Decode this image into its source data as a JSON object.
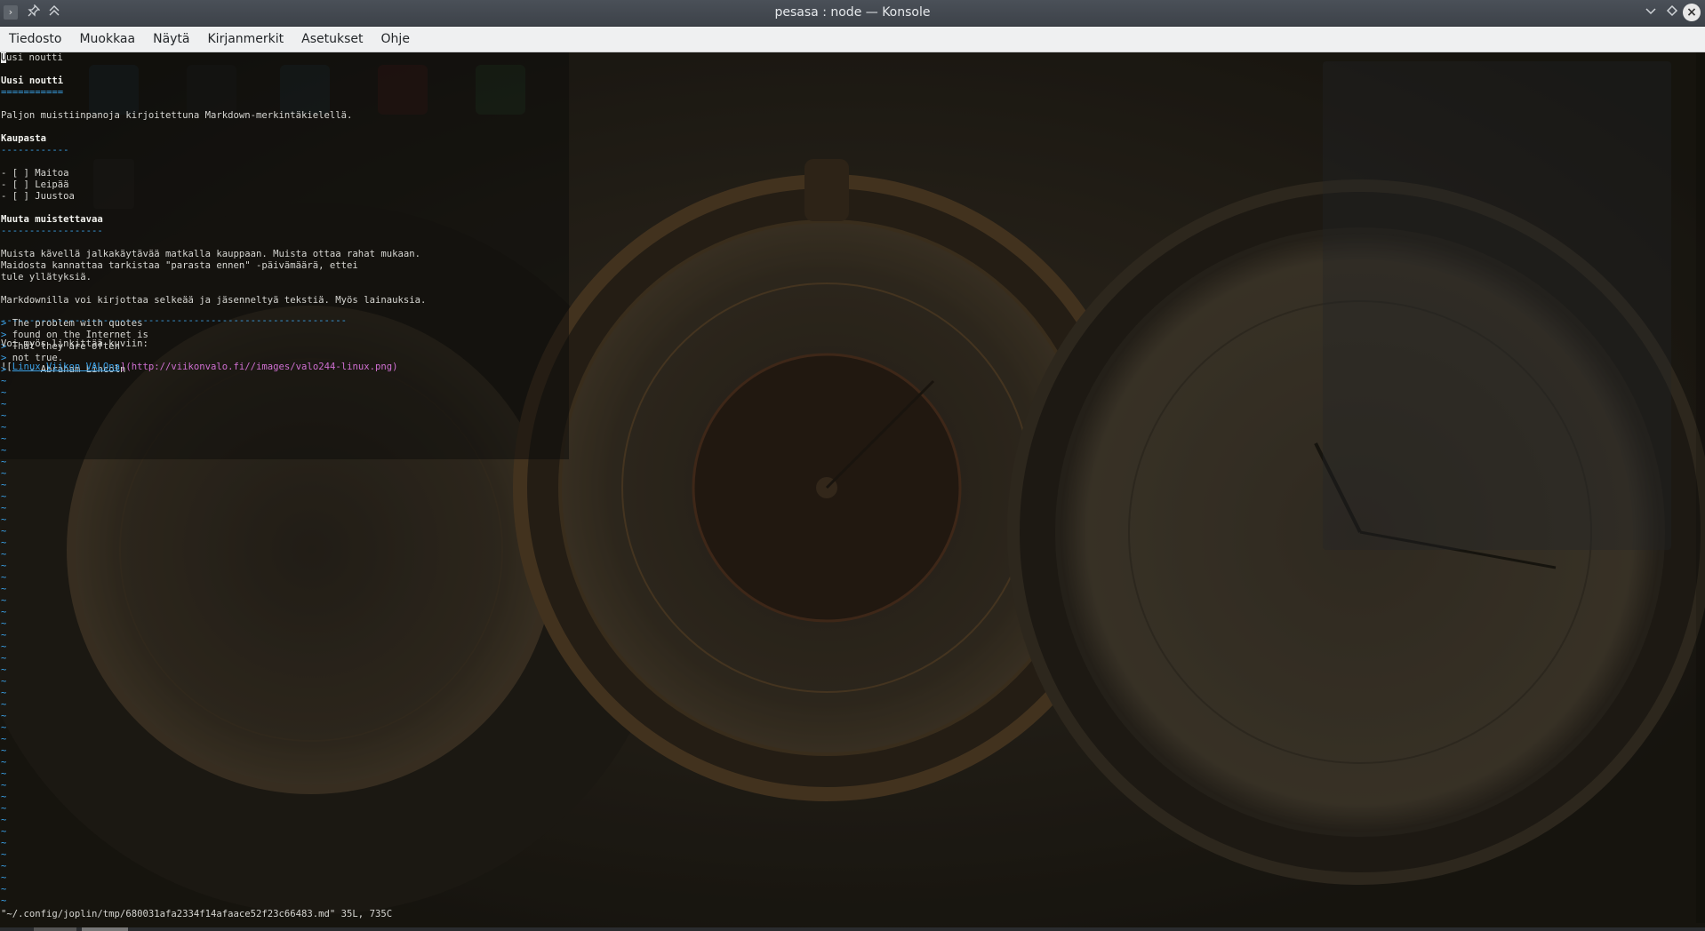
{
  "window": {
    "title": "pesasa : node — Konsole"
  },
  "menubar": {
    "items": [
      "Tiedosto",
      "Muokkaa",
      "Näytä",
      "Kirjanmerkit",
      "Asetukset",
      "Ohje"
    ]
  },
  "editor": {
    "first_line_rest": "usi noutti",
    "first_line_char": "U",
    "lines": [
      {
        "text": "",
        "style": ""
      },
      {
        "text": "Uusi noutti",
        "style": "bold"
      },
      {
        "text": "===========",
        "style": "blue"
      },
      {
        "text": "",
        "style": ""
      },
      {
        "text": "Paljon muistiinpanoja kirjoitettuna Markdown-merkintäkielellä.",
        "style": ""
      },
      {
        "text": "",
        "style": ""
      },
      {
        "text": "Kaupasta",
        "style": "bold"
      },
      {
        "text": "------------",
        "style": "blue"
      },
      {
        "text": "",
        "style": ""
      },
      {
        "text": "- [ ] Maitoa",
        "style": ""
      },
      {
        "text": "- [ ] Leipää",
        "style": ""
      },
      {
        "text": "- [ ] Juustoa",
        "style": ""
      },
      {
        "text": "",
        "style": ""
      },
      {
        "text": "Muuta muistettavaa",
        "style": "bold"
      },
      {
        "text": "------------------",
        "style": "blue"
      },
      {
        "text": "",
        "style": ""
      },
      {
        "text": "Muista kävellä jalkakäytävää matkalla kauppaan. Muista ottaa rahat mukaan.",
        "style": ""
      },
      {
        "text": "Maidosta kannattaa tarkistaa \"parasta ennen\" -päivämäärä, ettei",
        "style": ""
      },
      {
        "text": "tule yllätyksiä.",
        "style": ""
      },
      {
        "text": "",
        "style": ""
      },
      {
        "text": "Markdownilla voi kirjottaa selkeää ja jäsenneltyä tekstiä. Myös lainauksia.",
        "style": ""
      },
      {
        "text": "",
        "style": ""
      }
    ],
    "quote_marker": ">",
    "quote_lines": [
      " The problem with quotes",
      " found on the Internet is",
      " That they are often",
      " not true.",
      "    - Abraham Lincoln"
    ],
    "rule": "-------------------------------------------------------------",
    "link_intro": "Voi myös linkittää kuviin:",
    "image_link": {
      "prefix": "![",
      "text": "Linux Viikon VALOna",
      "middle": "](",
      "url": "http://viikonvalo.fi//images/valo244-linux.png",
      "suffix": ")"
    },
    "tilde": "~",
    "status": "\"~/.config/joplin/tmp/680031afa2334f14afaace52f23c66483.md\" 35L, 735C"
  }
}
